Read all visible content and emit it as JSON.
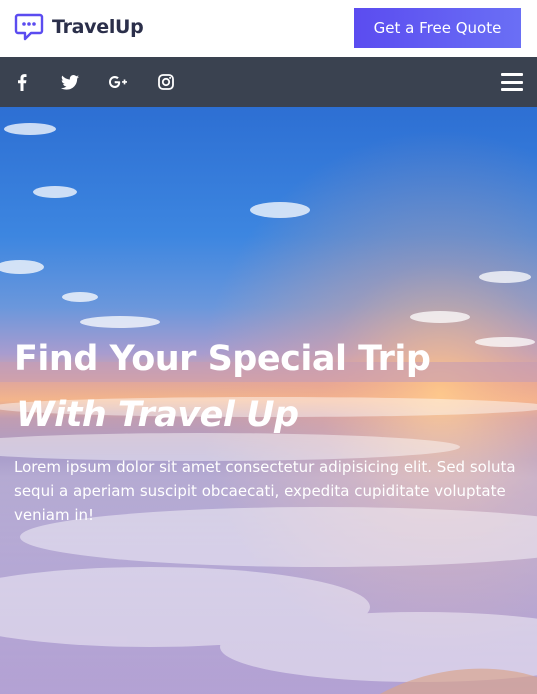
{
  "header": {
    "brand": "TravelUp",
    "cta_label": "Get a Free Quote"
  },
  "social": {
    "icons": [
      "facebook-icon",
      "twitter-icon",
      "google-plus-icon",
      "instagram-icon"
    ],
    "menu_icon": "hamburger-menu-icon"
  },
  "hero": {
    "title_line1": "Find Your Special Trip",
    "title_line2": "With Travel Up",
    "description": "Lorem ipsum dolor sit amet consectetur adipisicing elit. Sed soluta sequi a aperiam suscipit obcaecati, expedita cupiditate voluptate veniam in!"
  },
  "colors": {
    "accent": "#5b4cf0",
    "brand_text": "#2b2f4a",
    "social_bar": "#3a4250"
  }
}
